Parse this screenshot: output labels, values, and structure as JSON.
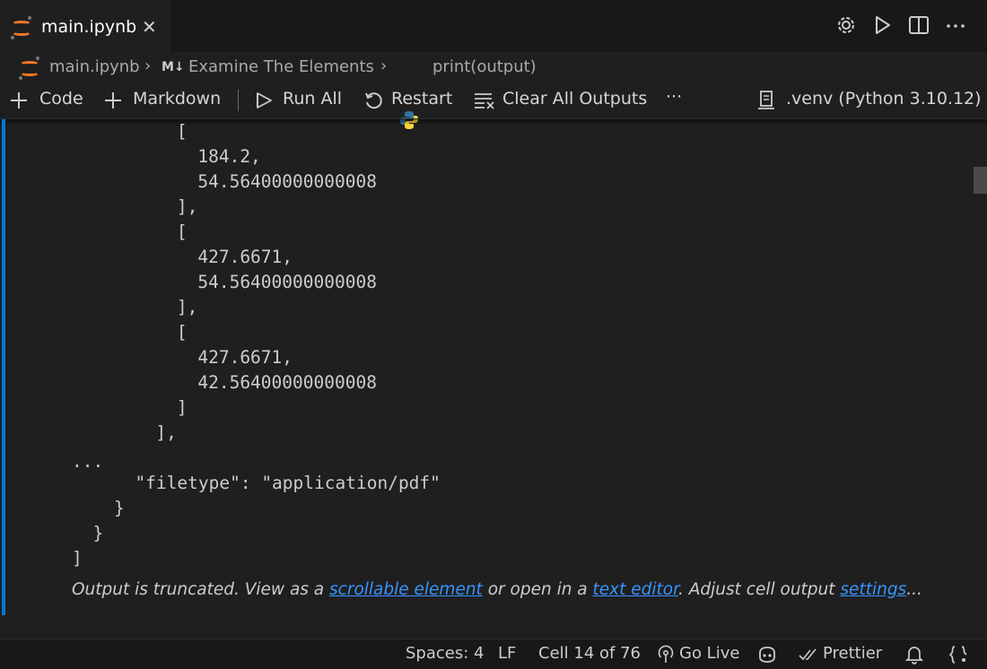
{
  "tab": {
    "title": "main.ipynb",
    "close_glyph": "✕"
  },
  "breadcrumb": {
    "file": "main.ipynb",
    "markdown_badge": "M↓",
    "section": "Examine The Elements",
    "cell": "print(output)"
  },
  "toolbar": {
    "code_label": "Code",
    "markdown_label": "Markdown",
    "run_all_label": "Run All",
    "restart_label": "Restart",
    "clear_outputs_label": "Clear All Outputs",
    "more_label": "···",
    "kernel_label": ".venv (Python 3.10.12)"
  },
  "output_lines": [
    "            [",
    "              184.2,",
    "              54.56400000000008",
    "            ],",
    "            [",
    "              427.6671,",
    "              427.6671,",
    "              54.56400000000008",
    "            ],",
    "            [",
    "              427.6671,",
    "              42.56400000000008",
    "            ]",
    "          ],",
    "...",
    "      \"filetype\": \"application/pdf\"",
    "    }",
    "  }",
    "]"
  ],
  "truncation": {
    "prefix": "Output is truncated. View as a ",
    "link_scrollable": "scrollable element",
    "middle": " or open in a ",
    "link_editor": "text editor",
    "middle2": ". Adjust cell output ",
    "link_settings": "settings",
    "suffix": "..."
  },
  "statusbar": {
    "spaces": "Spaces: 4",
    "eol": "LF",
    "cell_position": "Cell 14 of 76",
    "go_live": "Go Live",
    "prettier": "Prettier"
  },
  "colors": {
    "accent": "#0078d4",
    "link": "#3794ff",
    "jupyter_orange": "#f37726"
  }
}
